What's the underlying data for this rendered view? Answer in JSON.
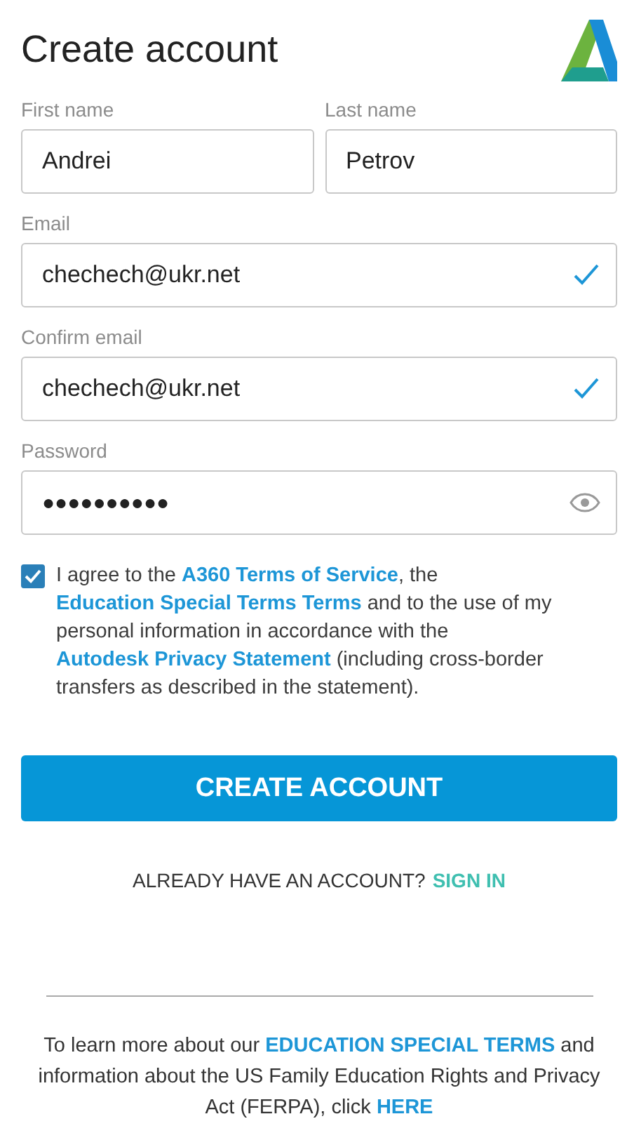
{
  "title": "Create account",
  "name_fields": [
    {
      "label": "First name",
      "value": "Andrei"
    },
    {
      "label": "Last name",
      "value": "Petrov"
    }
  ],
  "fields": [
    {
      "label": "Email",
      "value": "chechech@ukr.net",
      "kind": "text",
      "valid": true
    },
    {
      "label": "Confirm email",
      "value": "chechech@ukr.net",
      "kind": "text",
      "valid": true
    },
    {
      "label": "Password",
      "value": "●●●●●●●●●●",
      "kind": "password",
      "valid": false
    }
  ],
  "agreement": {
    "checked": true,
    "segments": [
      {
        "kind": "text",
        "text": "I agree to the "
      },
      {
        "kind": "link",
        "text": "A360 Terms of Service"
      },
      {
        "kind": "text",
        "text": ", the "
      },
      {
        "kind": "link",
        "text": "Education Special Terms Terms"
      },
      {
        "kind": "text",
        "text": " and to the use of my personal information in accordance with the "
      },
      {
        "kind": "link",
        "text": "Autodesk Privacy Statement"
      },
      {
        "kind": "text",
        "text": " (including cross-border transfers as described in the statement)."
      }
    ]
  },
  "submit_button": "CREATE ACCOUNT",
  "sign_in": {
    "prompt": "ALREADY HAVE AN ACCOUNT?",
    "link": "SIGN IN"
  },
  "footer": {
    "segments": [
      {
        "kind": "text",
        "text": "To learn more about our "
      },
      {
        "kind": "link",
        "text": "EDUCATION SPECIAL TERMS"
      },
      {
        "kind": "text",
        "text": " and information about the US Family Education Rights and Privacy Act (FERPA), click "
      },
      {
        "kind": "link",
        "text": "HERE"
      }
    ]
  }
}
